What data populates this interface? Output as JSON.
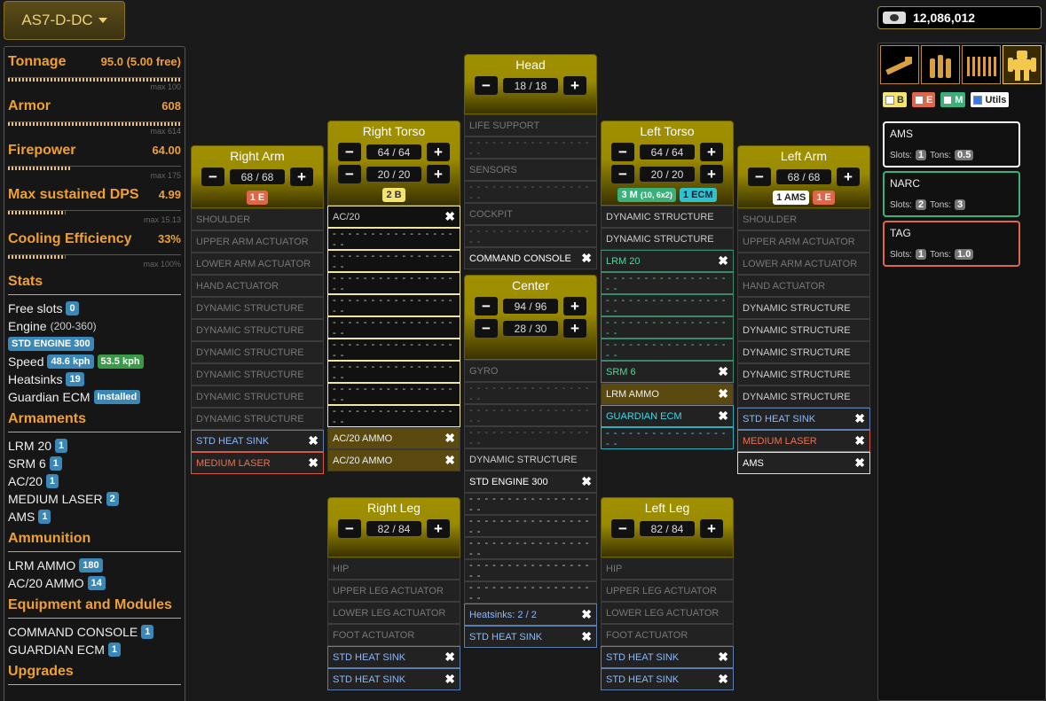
{
  "variant": {
    "label": "AS7-D-DC"
  },
  "cbills": "12,086,012",
  "stats": {
    "tonnage": {
      "label": "Tonnage",
      "value": "95.0 (5.00 free)",
      "max": "max 100"
    },
    "armor": {
      "label": "Armor",
      "value": "608",
      "max": "max 614"
    },
    "firepower": {
      "label": "Firepower",
      "value": "64.00",
      "max": "max 175"
    },
    "dps": {
      "label": "Max sustained DPS",
      "value": "4.99",
      "max": "max 15.13"
    },
    "cooling": {
      "label": "Cooling Efficiency",
      "value": "33%",
      "max": "max 100%"
    }
  },
  "sections": {
    "stats": "Stats",
    "armaments": "Armaments",
    "ammunition": "Ammunition",
    "equipment": "Equipment and Modules",
    "upgrades": "Upgrades"
  },
  "stats_list": {
    "free_slots": {
      "label": "Free slots",
      "value": "0"
    },
    "engine": {
      "label": "Engine",
      "range": "(200-360)",
      "badge": "STD ENGINE 300"
    },
    "speed": {
      "label": "Speed",
      "v1": "48.6 kph",
      "v2": "53.5 kph"
    },
    "heatsinks": {
      "label": "Heatsinks",
      "value": "19"
    },
    "ecm": {
      "label": "Guardian ECM",
      "value": "Installed"
    }
  },
  "armaments": [
    {
      "name": "LRM 20",
      "count": "1"
    },
    {
      "name": "SRM 6",
      "count": "1"
    },
    {
      "name": "AC/20",
      "count": "1"
    },
    {
      "name": "MEDIUM LASER",
      "count": "2"
    },
    {
      "name": "AMS",
      "count": "1"
    }
  ],
  "ammunition": [
    {
      "name": "LRM AMMO",
      "count": "180"
    },
    {
      "name": "AC/20 AMMO",
      "count": "14"
    }
  ],
  "equipment": [
    {
      "name": "COMMAND CONSOLE",
      "count": "1"
    },
    {
      "name": "GUARDIAN ECM",
      "count": "1"
    }
  ],
  "empty": "- - - - - - - - - - - - - - - - - -",
  "parts": {
    "rarm": {
      "title": "Right Arm",
      "armor": "68 / 68",
      "tags": [
        "1 E"
      ],
      "slots": [
        "SHOULDER",
        "UPPER ARM ACTUATOR",
        "LOWER ARM ACTUATOR",
        "HAND ACTUATOR",
        "DYNAMIC STRUCTURE",
        "DYNAMIC STRUCTURE",
        "DYNAMIC STRUCTURE",
        "DYNAMIC STRUCTURE",
        "DYNAMIC STRUCTURE",
        "DYNAMIC STRUCTURE",
        "STD HEAT SINK",
        "MEDIUM LASER"
      ]
    },
    "rtorso": {
      "title": "Right Torso",
      "front": "64 / 64",
      "rear": "20 / 20",
      "tags": [
        "2 B"
      ],
      "slots": [
        "AC/20",
        "AC/20 AMMO",
        "AC/20 AMMO"
      ]
    },
    "head": {
      "title": "Head",
      "armor": "18 / 18",
      "slots": [
        "LIFE SUPPORT",
        "SENSORS",
        "COCKPIT",
        "COMMAND CONSOLE"
      ]
    },
    "center": {
      "title": "Center",
      "front": "94 / 96",
      "rear": "28 / 30",
      "slots": [
        "GYRO",
        "DYNAMIC STRUCTURE",
        "STD ENGINE 300",
        "Heatsinks: 2 / 2",
        "STD HEAT SINK"
      ]
    },
    "ltorso": {
      "title": "Left Torso",
      "front": "64 / 64",
      "rear": "20 / 20",
      "tags": [
        "3 M",
        "(10, 6x2)",
        "1 ECM"
      ],
      "slots": [
        "DYNAMIC STRUCTURE",
        "DYNAMIC STRUCTURE",
        "LRM 20",
        "SRM 6",
        "LRM AMMO",
        "GUARDIAN ECM"
      ]
    },
    "larm": {
      "title": "Left Arm",
      "armor": "68 / 68",
      "tags": [
        "1 AMS",
        "1 E"
      ],
      "slots": [
        "SHOULDER",
        "UPPER ARM ACTUATOR",
        "LOWER ARM ACTUATOR",
        "HAND ACTUATOR",
        "DYNAMIC STRUCTURE",
        "DYNAMIC STRUCTURE",
        "DYNAMIC STRUCTURE",
        "DYNAMIC STRUCTURE",
        "DYNAMIC STRUCTURE",
        "STD HEAT SINK",
        "MEDIUM LASER",
        "AMS"
      ]
    },
    "rleg": {
      "title": "Right Leg",
      "armor": "82 / 84",
      "slots": [
        "HIP",
        "UPPER LEG ACTUATOR",
        "LOWER LEG ACTUATOR",
        "FOOT ACTUATOR",
        "STD HEAT SINK",
        "STD HEAT SINK"
      ]
    },
    "lleg": {
      "title": "Left Leg",
      "armor": "82 / 84",
      "slots": [
        "HIP",
        "UPPER LEG ACTUATOR",
        "LOWER LEG ACTUATOR",
        "FOOT ACTUATOR",
        "STD HEAT SINK",
        "STD HEAT SINK"
      ]
    }
  },
  "filters": {
    "b": "B",
    "e": "E",
    "m": "M",
    "u": "Utils"
  },
  "utils": [
    {
      "name": "AMS",
      "slots_label": "Slots:",
      "slots": "1",
      "tons_label": "Tons:",
      "tons": "0.5"
    },
    {
      "name": "NARC",
      "slots_label": "Slots:",
      "slots": "2",
      "tons_label": "Tons:",
      "tons": "3"
    },
    {
      "name": "TAG",
      "slots_label": "Slots:",
      "slots": "1",
      "tons_label": "Tons:",
      "tons": "1.0"
    }
  ],
  "colors": {
    "accent": "#f0a030",
    "energy": "#e0664a",
    "ballistic": "#f6e470",
    "missile": "#3ab07a",
    "ecm": "#2bc4d0"
  }
}
